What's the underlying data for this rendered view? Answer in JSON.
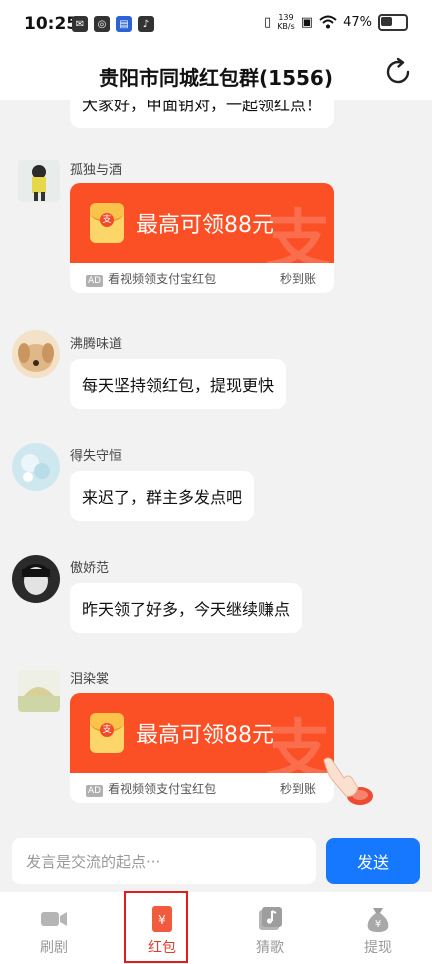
{
  "status_bar": {
    "time": "10:25",
    "net_speed_value": "139",
    "net_speed_unit": "KB/s",
    "battery": "47%"
  },
  "header": {
    "title": "贵阳市同城红包群(1556)"
  },
  "messages": [
    {
      "type": "text",
      "user": "",
      "text": "大家好，甲面钥对，一起领红点！"
    },
    {
      "type": "redpacket",
      "user": "孤独与酒",
      "title": "最高可领88元",
      "ad": "AD",
      "desc": "看视频领支付宝红包",
      "note": "秒到账"
    },
    {
      "type": "text",
      "user": "沸腾味道",
      "text": "每天坚持领红包，提现更快"
    },
    {
      "type": "text",
      "user": "得失守恒",
      "text": "来迟了，群主多发点吧"
    },
    {
      "type": "text",
      "user": "傲娇范",
      "text": "昨天领了好多，今天继续赚点"
    },
    {
      "type": "redpacket",
      "user": "泪染裳",
      "title": "最高可领88元",
      "ad": "AD",
      "desc": "看视频领支付宝红包",
      "note": "秒到账"
    }
  ],
  "input": {
    "placeholder": "发言是交流的起点···",
    "send_label": "发送"
  },
  "tabs": [
    {
      "label": "刷剧",
      "icon": "video-icon",
      "active": false
    },
    {
      "label": "红包",
      "icon": "redpacket-icon",
      "active": true
    },
    {
      "label": "猜歌",
      "icon": "music-icon",
      "active": false
    },
    {
      "label": "提现",
      "icon": "money-bag-icon",
      "active": false
    }
  ],
  "colors": {
    "accent_blue": "#1677ff",
    "redpacket_orange": "#fb4f26",
    "active_tab": "#e03e2d",
    "highlight_border": "#e21b1b"
  }
}
